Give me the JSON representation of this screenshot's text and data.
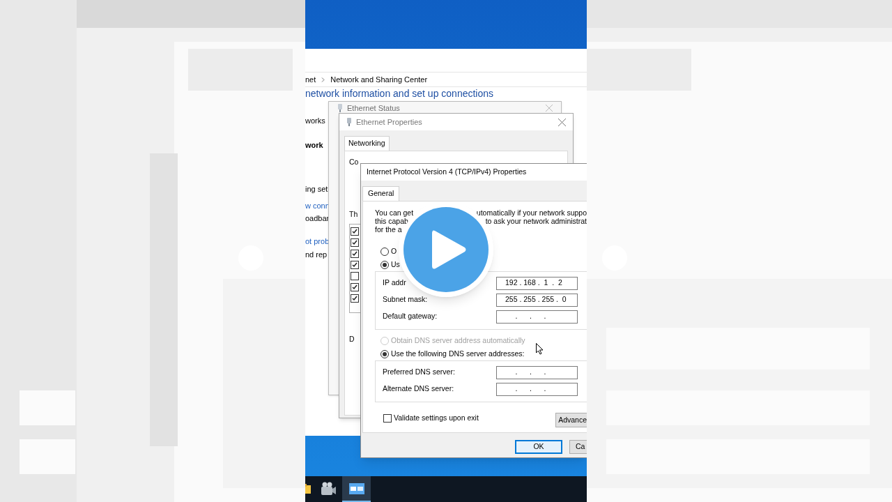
{
  "explorer": {
    "breadcrumb": [
      "net",
      "Network and Sharing Center"
    ],
    "heading": "network information and set up connections",
    "sidebar": [
      {
        "text": "works",
        "bold": false,
        "link": false
      },
      {
        "text": "work",
        "bold": true,
        "link": false
      },
      {
        "text": "ing set",
        "bold": false,
        "link": false
      },
      {
        "text": "w conn",
        "bold": false,
        "link": true
      },
      {
        "text": "oadbar",
        "bold": false,
        "link": false
      },
      {
        "text": "ot prob",
        "bold": false,
        "link": true
      },
      {
        "text": "nd rep",
        "bold": false,
        "link": false
      }
    ]
  },
  "status_window": {
    "title": "Ethernet Status"
  },
  "properties_window": {
    "title": "Ethernet Properties",
    "tabs": [
      {
        "label": "Networking",
        "selected": true
      }
    ],
    "connect_label": "Co",
    "list_label": "Th",
    "description_label": "D",
    "components": [
      {
        "checked": true
      },
      {
        "checked": true
      },
      {
        "checked": true
      },
      {
        "checked": true
      },
      {
        "checked": false
      },
      {
        "checked": true
      },
      {
        "checked": true
      }
    ]
  },
  "ipv4_dialog": {
    "title": "Internet Protocol Version 4 (TCP/IPv4) Properties",
    "tabs": [
      {
        "label": "General",
        "selected": true
      }
    ],
    "description": [
      {
        "left": "You can get",
        "right": "utomatically if your network suppo"
      },
      {
        "left": "this capab",
        "right": "to ask your network administrat"
      },
      {
        "left": "for the a"
      }
    ],
    "ip_mode": [
      {
        "label": "O",
        "selected": false,
        "disabled": false
      },
      {
        "label": "Us",
        "selected": true,
        "disabled": false
      }
    ],
    "ip_fields": [
      {
        "label": "IP addr",
        "value": "192 . 168 .  1  .  2"
      },
      {
        "label": "Subnet mask:",
        "value": "255 . 255 . 255 .  0"
      },
      {
        "label": "Default gateway:",
        "value": "     .      .      ."
      }
    ],
    "dns_mode": [
      {
        "label": "Obtain DNS server address automatically",
        "selected": false,
        "disabled": true
      },
      {
        "label": "Use the following DNS server addresses:",
        "selected": true,
        "disabled": false
      }
    ],
    "dns_fields": [
      {
        "label": "Preferred DNS server:",
        "value": "     .      .      ."
      },
      {
        "label": "Alternate DNS server:",
        "value": "     .      .      ."
      }
    ],
    "validate": {
      "label": "Validate settings upon exit",
      "checked": false
    },
    "buttons": [
      {
        "label": "OK",
        "default": true
      },
      {
        "label": "Ca",
        "default": false
      }
    ],
    "advanced_button": {
      "label": "Advance"
    }
  },
  "taskbar": {
    "items": [
      {
        "kind": "folder",
        "selected": false
      },
      {
        "kind": "camera",
        "selected": false
      },
      {
        "kind": "network",
        "selected": true
      }
    ]
  }
}
